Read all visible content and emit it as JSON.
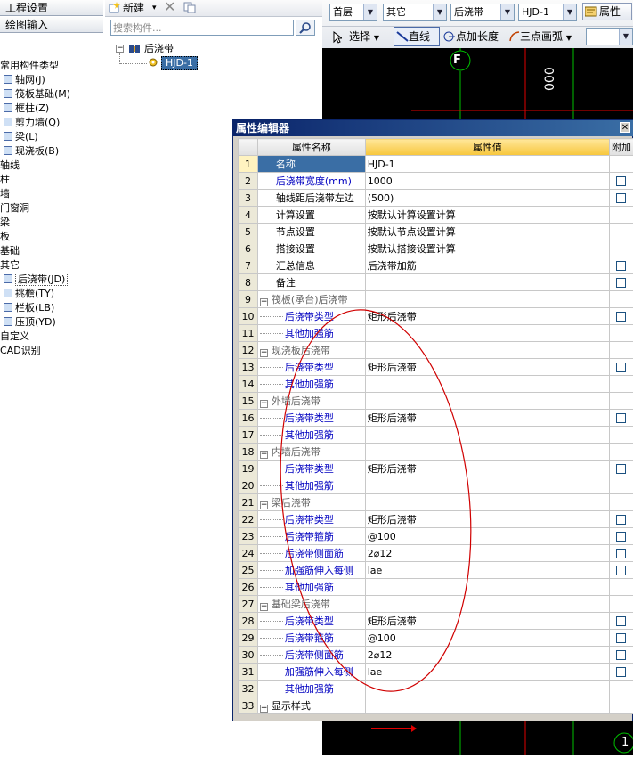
{
  "left_nav": {
    "buttons": [
      "工程设置",
      "绘图输入"
    ],
    "tree": [
      {
        "label": "常用构件类型",
        "indent": 0,
        "icon": false
      },
      {
        "label": "轴网(J)",
        "indent": 1,
        "icon": true,
        "icon_name": "grid-icon"
      },
      {
        "label": "筏板基础(M)",
        "indent": 1,
        "icon": true,
        "icon_name": "raft-icon"
      },
      {
        "label": "框柱(Z)",
        "indent": 1,
        "icon": true,
        "icon_name": "column-icon"
      },
      {
        "label": "剪力墙(Q)",
        "indent": 1,
        "icon": true,
        "icon_name": "wall-icon"
      },
      {
        "label": "梁(L)",
        "indent": 1,
        "icon": true,
        "icon_name": "beam-icon"
      },
      {
        "label": "现浇板(B)",
        "indent": 1,
        "icon": true,
        "icon_name": "slab-icon"
      },
      {
        "label": "轴线",
        "indent": 0,
        "icon": false
      },
      {
        "label": "柱",
        "indent": 0,
        "icon": false
      },
      {
        "label": "墙",
        "indent": 0,
        "icon": false
      },
      {
        "label": "门窗洞",
        "indent": 0,
        "icon": false
      },
      {
        "label": "梁",
        "indent": 0,
        "icon": false
      },
      {
        "label": "板",
        "indent": 0,
        "icon": false
      },
      {
        "label": "基础",
        "indent": 0,
        "icon": false
      },
      {
        "label": "其它",
        "indent": 0,
        "icon": false
      },
      {
        "label": "后浇带(JD)",
        "indent": 1,
        "icon": true,
        "icon_name": "post-cast-strip-icon",
        "selected": true
      },
      {
        "label": "挑檐(TY)",
        "indent": 1,
        "icon": true,
        "icon_name": "cornice-icon"
      },
      {
        "label": "栏板(LB)",
        "indent": 1,
        "icon": true,
        "icon_name": "parapet-icon"
      },
      {
        "label": "压顶(YD)",
        "indent": 1,
        "icon": true,
        "icon_name": "coping-icon"
      },
      {
        "label": "自定义",
        "indent": 0,
        "icon": false
      },
      {
        "label": "CAD识别",
        "indent": 0,
        "icon": false
      }
    ]
  },
  "mid_panel": {
    "new_label": "新建",
    "search_placeholder": "搜索构件...",
    "tree_root": "后浇带",
    "tree_child": "HJD-1"
  },
  "top_toolbar": {
    "floor": "首层",
    "category": "其它",
    "type": "后浇带",
    "component": "HJD-1",
    "properties_button": "属性",
    "select_button": "选择",
    "line_button": "直线",
    "point_length_button": "点加长度",
    "arc_button": "三点画弧"
  },
  "canvas": {
    "axis_top": "F",
    "axis_bottom": "1",
    "dim_text": "000"
  },
  "dialog": {
    "title": "属性编辑器",
    "col_num": "",
    "col_name": "属性名称",
    "col_value": "属性值",
    "col_extra": "附加",
    "rows": [
      {
        "n": "1",
        "name": "名称",
        "value": "HJD-1",
        "style": "plain",
        "cb": false,
        "selected": true
      },
      {
        "n": "2",
        "name": "后浇带宽度(mm)",
        "value": "1000",
        "style": "blue",
        "cb": true
      },
      {
        "n": "3",
        "name": "轴线距后浇带左边",
        "value": "(500)",
        "style": "plain",
        "cb": true
      },
      {
        "n": "4",
        "name": "计算设置",
        "value": "按默认计算设置计算",
        "style": "plain",
        "cb": false
      },
      {
        "n": "5",
        "name": "节点设置",
        "value": "按默认节点设置计算",
        "style": "plain",
        "cb": false
      },
      {
        "n": "6",
        "name": "搭接设置",
        "value": "按默认搭接设置计算",
        "style": "plain",
        "cb": false
      },
      {
        "n": "7",
        "name": "汇总信息",
        "value": "后浇带加筋",
        "style": "plain",
        "cb": true
      },
      {
        "n": "8",
        "name": "备注",
        "value": "",
        "style": "plain",
        "cb": true
      },
      {
        "n": "9",
        "name": "筏板(承台)后浇带",
        "value": "",
        "style": "group",
        "cb": false
      },
      {
        "n": "10",
        "name": "后浇带类型",
        "value": "矩形后浇带",
        "style": "child",
        "cb": true
      },
      {
        "n": "11",
        "name": "其他加强筋",
        "value": "",
        "style": "child",
        "cb": false
      },
      {
        "n": "12",
        "name": "现浇板后浇带",
        "value": "",
        "style": "group",
        "cb": false
      },
      {
        "n": "13",
        "name": "后浇带类型",
        "value": "矩形后浇带",
        "style": "child",
        "cb": true
      },
      {
        "n": "14",
        "name": "其他加强筋",
        "value": "",
        "style": "child",
        "cb": false
      },
      {
        "n": "15",
        "name": "外墙后浇带",
        "value": "",
        "style": "group",
        "cb": false
      },
      {
        "n": "16",
        "name": "后浇带类型",
        "value": "矩形后浇带",
        "style": "child",
        "cb": true
      },
      {
        "n": "17",
        "name": "其他加强筋",
        "value": "",
        "style": "child",
        "cb": false
      },
      {
        "n": "18",
        "name": "内墙后浇带",
        "value": "",
        "style": "group",
        "cb": false
      },
      {
        "n": "19",
        "name": "后浇带类型",
        "value": "矩形后浇带",
        "style": "child",
        "cb": true
      },
      {
        "n": "20",
        "name": "其他加强筋",
        "value": "",
        "style": "child",
        "cb": false
      },
      {
        "n": "21",
        "name": "梁后浇带",
        "value": "",
        "style": "group",
        "cb": false
      },
      {
        "n": "22",
        "name": "后浇带类型",
        "value": "矩形后浇带",
        "style": "child",
        "cb": true
      },
      {
        "n": "23",
        "name": "后浇带箍筋",
        "value": "@100",
        "style": "child",
        "cb": true
      },
      {
        "n": "24",
        "name": "后浇带侧面筋",
        "value": "2⌀12",
        "style": "child",
        "cb": true
      },
      {
        "n": "25",
        "name": "加强筋伸入每侧",
        "value": "lae",
        "style": "child",
        "cb": true
      },
      {
        "n": "26",
        "name": "其他加强筋",
        "value": "",
        "style": "child",
        "cb": false
      },
      {
        "n": "27",
        "name": "基础梁后浇带",
        "value": "",
        "style": "group",
        "cb": false
      },
      {
        "n": "28",
        "name": "后浇带类型",
        "value": "矩形后浇带",
        "style": "child",
        "cb": true
      },
      {
        "n": "29",
        "name": "后浇带箍筋",
        "value": "@100",
        "style": "child",
        "cb": true
      },
      {
        "n": "30",
        "name": "后浇带侧面筋",
        "value": "2⌀12",
        "style": "child",
        "cb": true
      },
      {
        "n": "31",
        "name": "加强筋伸入每侧",
        "value": "lae",
        "style": "child",
        "cb": true
      },
      {
        "n": "32",
        "name": "其他加强筋",
        "value": "",
        "style": "child",
        "cb": false
      },
      {
        "n": "33",
        "name": "显示样式",
        "value": "",
        "style": "collapsed",
        "cb": false
      }
    ]
  },
  "colors": {
    "selection": "#3a6ea5",
    "annotation_ellipse": "#d00000",
    "grid_line_green": "#00c000",
    "grid_line_red": "#e00000"
  }
}
